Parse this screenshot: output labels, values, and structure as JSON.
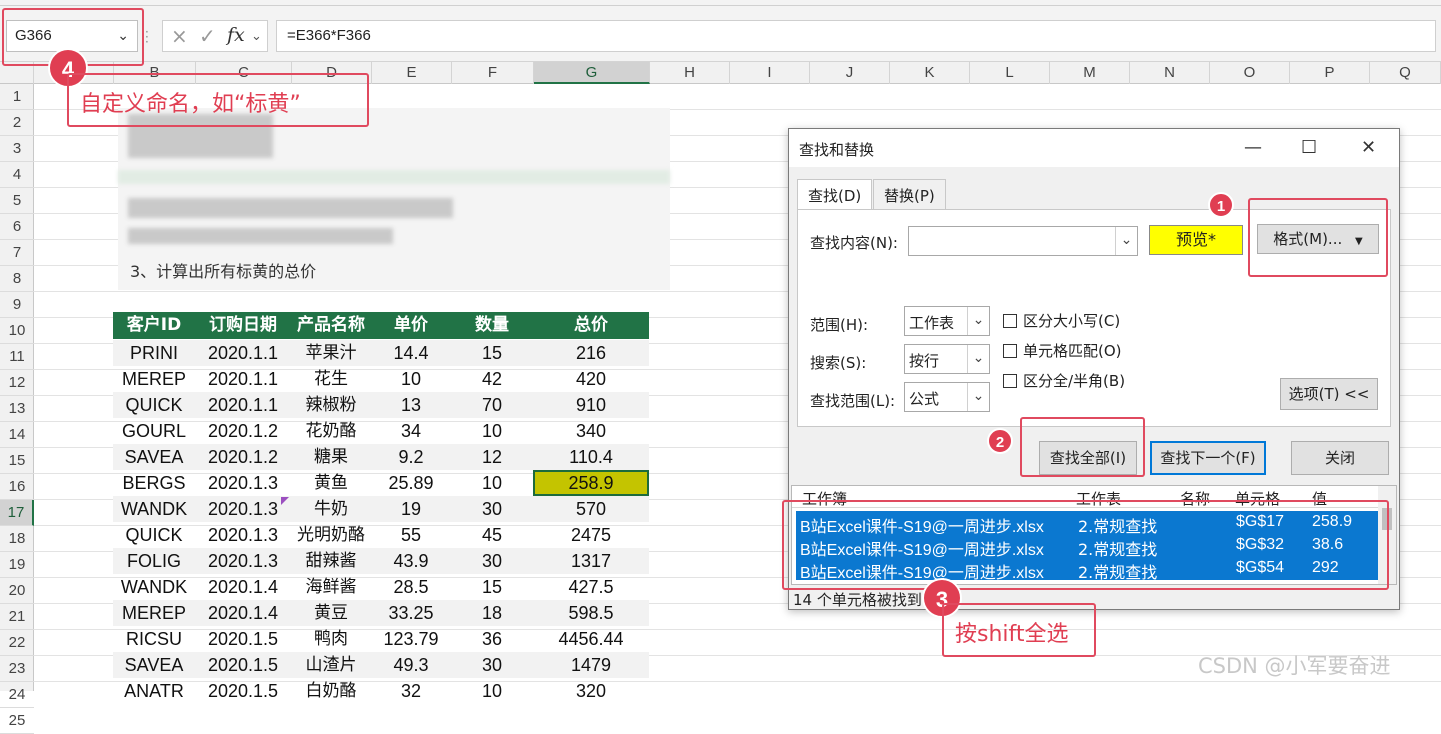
{
  "formula_bar": {
    "name_box": "G366",
    "fx_cancel": "×",
    "fx_enter": "✓",
    "fx_label": "fx",
    "formula": "=E366*F366"
  },
  "columns": [
    "B",
    "C",
    "D",
    "E",
    "F",
    "G",
    "H",
    "I",
    "J",
    "K",
    "L",
    "M",
    "N",
    "O",
    "P",
    "Q"
  ],
  "rows": [
    "1",
    "2",
    "3",
    "4",
    "5",
    "6",
    "7",
    "8",
    "9",
    "10",
    "11",
    "12",
    "13",
    "14",
    "15",
    "16",
    "17",
    "18",
    "19",
    "20",
    "21",
    "22",
    "23",
    "24",
    "25"
  ],
  "sheet": {
    "task_text": "3、计算出所有标黄的总价",
    "headers": [
      "客户ID",
      "订购日期",
      "产品名称",
      "单价",
      "数量",
      "总价"
    ],
    "rows": [
      [
        "PRINI",
        "2020.1.1",
        "苹果汁",
        "14.4",
        "15",
        "216"
      ],
      [
        "MEREP",
        "2020.1.1",
        "花生",
        "10",
        "42",
        "420"
      ],
      [
        "QUICK",
        "2020.1.1",
        "辣椒粉",
        "13",
        "70",
        "910"
      ],
      [
        "GOURL",
        "2020.1.2",
        "花奶酪",
        "34",
        "10",
        "340"
      ],
      [
        "SAVEA",
        "2020.1.2",
        "糖果",
        "9.2",
        "12",
        "110.4"
      ],
      [
        "BERGS",
        "2020.1.3",
        "黄鱼",
        "25.89",
        "10",
        "258.9"
      ],
      [
        "WANDK",
        "2020.1.3",
        "牛奶",
        "19",
        "30",
        "570"
      ],
      [
        "QUICK",
        "2020.1.3",
        "光明奶酪",
        "55",
        "45",
        "2475"
      ],
      [
        "FOLIG",
        "2020.1.3",
        "甜辣酱",
        "43.9",
        "30",
        "1317"
      ],
      [
        "WANDK",
        "2020.1.4",
        "海鲜酱",
        "28.5",
        "15",
        "427.5"
      ],
      [
        "MEREP",
        "2020.1.4",
        "黄豆",
        "33.25",
        "18",
        "598.5"
      ],
      [
        "RICSU",
        "2020.1.5",
        "鸭肉",
        "123.79",
        "36",
        "4456.44"
      ],
      [
        "SAVEA",
        "2020.1.5",
        "山渣片",
        "49.3",
        "30",
        "1479"
      ],
      [
        "ANATR",
        "2020.1.5",
        "白奶酪",
        "32",
        "10",
        "320"
      ]
    ],
    "highlight_color": "#c4c400",
    "header_color": "#217346"
  },
  "dialog": {
    "title": "查找和替换",
    "minimize": "—",
    "maximize": "☐",
    "close": "✕",
    "tab_find": "查找(D)",
    "tab_replace": "替换(P)",
    "find_label": "查找内容(N):",
    "find_value": "",
    "preview": "预览*",
    "format_button": "格式(M)...",
    "scope_label": "范围(H):",
    "scope_value": "工作表",
    "search_label": "搜索(S):",
    "search_value": "按行",
    "lookin_label": "查找范围(L):",
    "lookin_value": "公式",
    "match_case": "区分大小写(C)",
    "match_cell": "单元格匹配(O)",
    "match_width": "区分全/半角(B)",
    "options_button": "选项(T) <<",
    "find_all": "查找全部(I)",
    "find_next": "查找下一个(F)",
    "close_button": "关闭",
    "result_headers": [
      "工作簿",
      "工作表",
      "名称",
      "单元格",
      "值"
    ],
    "results": [
      [
        "B站Excel课件-S19@一周进步.xlsx",
        "2.常规查找",
        "",
        "$G$17",
        "258.9"
      ],
      [
        "B站Excel课件-S19@一周进步.xlsx",
        "2.常规查找",
        "",
        "$G$32",
        "38.6"
      ],
      [
        "B站Excel课件-S19@一周进步.xlsx",
        "2.常规查找",
        "",
        "$G$54",
        "292"
      ]
    ],
    "status": "14 个单元格被找到"
  },
  "annotations": {
    "step1": "1",
    "step2": "2",
    "step3": "3",
    "step4": "4",
    "note4": "自定义命名，如“标黄”",
    "note3": "按shift全选"
  },
  "watermark": "CSDN @小军要奋进"
}
